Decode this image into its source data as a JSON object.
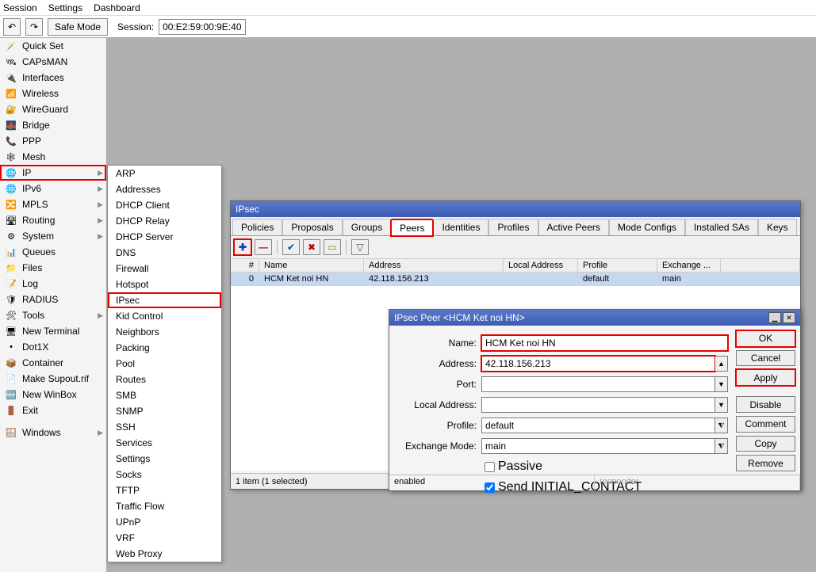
{
  "menubar": [
    "Session",
    "Settings",
    "Dashboard"
  ],
  "toolbar": {
    "undo": "↶",
    "redo": "↷",
    "safe_mode": "Safe Mode",
    "session_label": "Session:",
    "session_value": "00:E2:59:00:9E:40"
  },
  "sidebar": [
    {
      "icon": "🪄",
      "label": "Quick Set"
    },
    {
      "icon": "🛰",
      "label": "CAPsMAN"
    },
    {
      "icon": "🔌",
      "label": "Interfaces"
    },
    {
      "icon": "📶",
      "label": "Wireless"
    },
    {
      "icon": "🔐",
      "label": "WireGuard"
    },
    {
      "icon": "🌉",
      "label": "Bridge"
    },
    {
      "icon": "📞",
      "label": "PPP"
    },
    {
      "icon": "🕸",
      "label": "Mesh"
    },
    {
      "icon": "🌐",
      "label": "IP",
      "sub": true,
      "hl": true
    },
    {
      "icon": "🌐",
      "label": "IPv6",
      "sub": true
    },
    {
      "icon": "🔀",
      "label": "MPLS",
      "sub": true
    },
    {
      "icon": "🛣",
      "label": "Routing",
      "sub": true
    },
    {
      "icon": "⚙",
      "label": "System",
      "sub": true
    },
    {
      "icon": "📊",
      "label": "Queues"
    },
    {
      "icon": "📁",
      "label": "Files"
    },
    {
      "icon": "📝",
      "label": "Log"
    },
    {
      "icon": "🛡",
      "label": "RADIUS"
    },
    {
      "icon": "🛠",
      "label": "Tools",
      "sub": true
    },
    {
      "icon": "🖥",
      "label": "New Terminal"
    },
    {
      "icon": "•",
      "label": "Dot1X"
    },
    {
      "icon": "📦",
      "label": "Container"
    },
    {
      "icon": "📄",
      "label": "Make Supout.rif"
    },
    {
      "icon": "🆕",
      "label": "New WinBox"
    },
    {
      "icon": "🚪",
      "label": "Exit"
    },
    {
      "spacer": true
    },
    {
      "icon": "🪟",
      "label": "Windows",
      "sub": true
    }
  ],
  "submenu": [
    "ARP",
    "Addresses",
    "DHCP Client",
    "DHCP Relay",
    "DHCP Server",
    "DNS",
    "Firewall",
    "Hotspot",
    "IPsec",
    "Kid Control",
    "Neighbors",
    "Packing",
    "Pool",
    "Routes",
    "SMB",
    "SNMP",
    "SSH",
    "Services",
    "Settings",
    "Socks",
    "TFTP",
    "Traffic Flow",
    "UPnP",
    "VRF",
    "Web Proxy"
  ],
  "submenu_hl": "IPsec",
  "ipsec_window": {
    "title": "IPsec",
    "tabs": [
      "Policies",
      "Proposals",
      "Groups",
      "Peers",
      "Identities",
      "Profiles",
      "Active Peers",
      "Mode Configs",
      "Installed SAs",
      "Keys"
    ],
    "active_tab": "Peers",
    "columns": [
      "#",
      "Name",
      "Address",
      "Local Address",
      "Profile",
      "Exchange ..."
    ],
    "rows": [
      {
        "num": "0",
        "name": "HCM Ket noi HN",
        "addr": "42.118.156.213",
        "laddr": "",
        "profile": "default",
        "exch": "main"
      }
    ],
    "status": "1 item (1 selected)"
  },
  "peer_dialog": {
    "title": "IPsec Peer <HCM Ket noi HN>",
    "fields": {
      "name_label": "Name:",
      "name_value": "HCM Ket noi HN",
      "address_label": "Address:",
      "address_value": "42.118.156.213",
      "port_label": "Port:",
      "port_value": "",
      "laddr_label": "Local Address:",
      "laddr_value": "",
      "profile_label": "Profile:",
      "profile_value": "default",
      "exch_label": "Exchange Mode:",
      "exch_value": "main",
      "passive_label": "Passive",
      "passive_checked": false,
      "initial_label": "Send INITIAL_CONTACT",
      "initial_checked": true
    },
    "buttons": [
      "OK",
      "Cancel",
      "Apply",
      "Disable",
      "Comment",
      "Copy",
      "Remove"
    ],
    "hl_buttons": [
      "OK",
      "Apply"
    ],
    "status_left": "enabled",
    "status_right": "responder"
  }
}
